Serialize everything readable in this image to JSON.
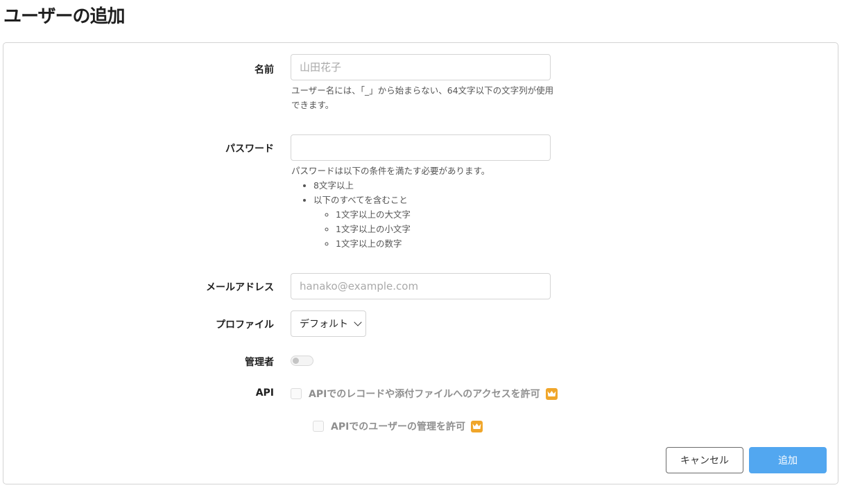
{
  "page": {
    "title": "ユーザーの追加"
  },
  "form": {
    "name": {
      "label": "名前",
      "placeholder": "山田花子",
      "value": "",
      "help": "ユーザー名には、「_」から始まらない、64文字以下の文字列が使用できます。"
    },
    "password": {
      "label": "パスワード",
      "value": "",
      "help_intro": "パスワードは以下の条件を満たす必要があります。",
      "rules": [
        "8文字以上",
        "以下のすべてを含むこと"
      ],
      "sub_rules": [
        "1文字以上の大文字",
        "1文字以上の小文字",
        "1文字以上の数字"
      ]
    },
    "email": {
      "label": "メールアドレス",
      "placeholder": "hanako@example.com",
      "value": ""
    },
    "profile": {
      "label": "プロファイル",
      "selected": "デフォルト"
    },
    "admin": {
      "label": "管理者",
      "enabled": false
    },
    "api": {
      "label": "API",
      "options": [
        {
          "label": "APIでのレコードや添付ファイルへのアクセスを許可",
          "checked": false,
          "premium_icon": "crown-icon"
        },
        {
          "label": "APIでのユーザーの管理を許可",
          "checked": false,
          "premium_icon": "crown-icon"
        }
      ]
    }
  },
  "actions": {
    "cancel_label": "キャンセル",
    "submit_label": "追加"
  },
  "colors": {
    "accent": "#52a7f0",
    "premium": "#f0a62a"
  }
}
